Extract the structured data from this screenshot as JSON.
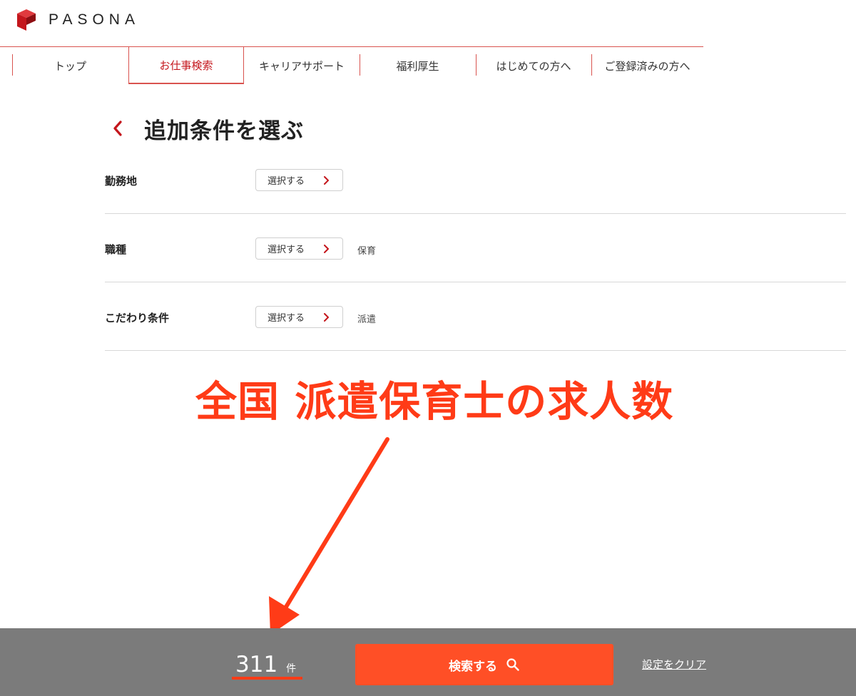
{
  "header": {
    "logo_text": "PASONA",
    "brand_color": "#c4161c"
  },
  "nav": {
    "items": [
      {
        "label": "トップ",
        "active": false
      },
      {
        "label": "お仕事検索",
        "active": true
      },
      {
        "label": "キャリアサポート",
        "active": false
      },
      {
        "label": "福利厚生",
        "active": false
      },
      {
        "label": "はじめての方へ",
        "active": false
      },
      {
        "label": "ご登録済みの方へ",
        "active": false
      }
    ]
  },
  "page": {
    "title": "追加条件を選ぶ",
    "back_icon": "chevron-left-icon"
  },
  "conditions": [
    {
      "label": "勤務地",
      "button": "選択する",
      "value": ""
    },
    {
      "label": "職種",
      "button": "選択する",
      "value": "保育"
    },
    {
      "label": "こだわり条件",
      "button": "選択する",
      "value": "派遣"
    }
  ],
  "annotation": {
    "text": "全国 派遣保育士の求人数",
    "color": "#ff3b17"
  },
  "footer": {
    "count": "311",
    "count_unit": "件",
    "search_label": "検索する",
    "search_icon": "search-icon",
    "clear_label": "設定をクリア",
    "bar_color": "#7b7b7b",
    "button_color": "#ff4f26"
  }
}
